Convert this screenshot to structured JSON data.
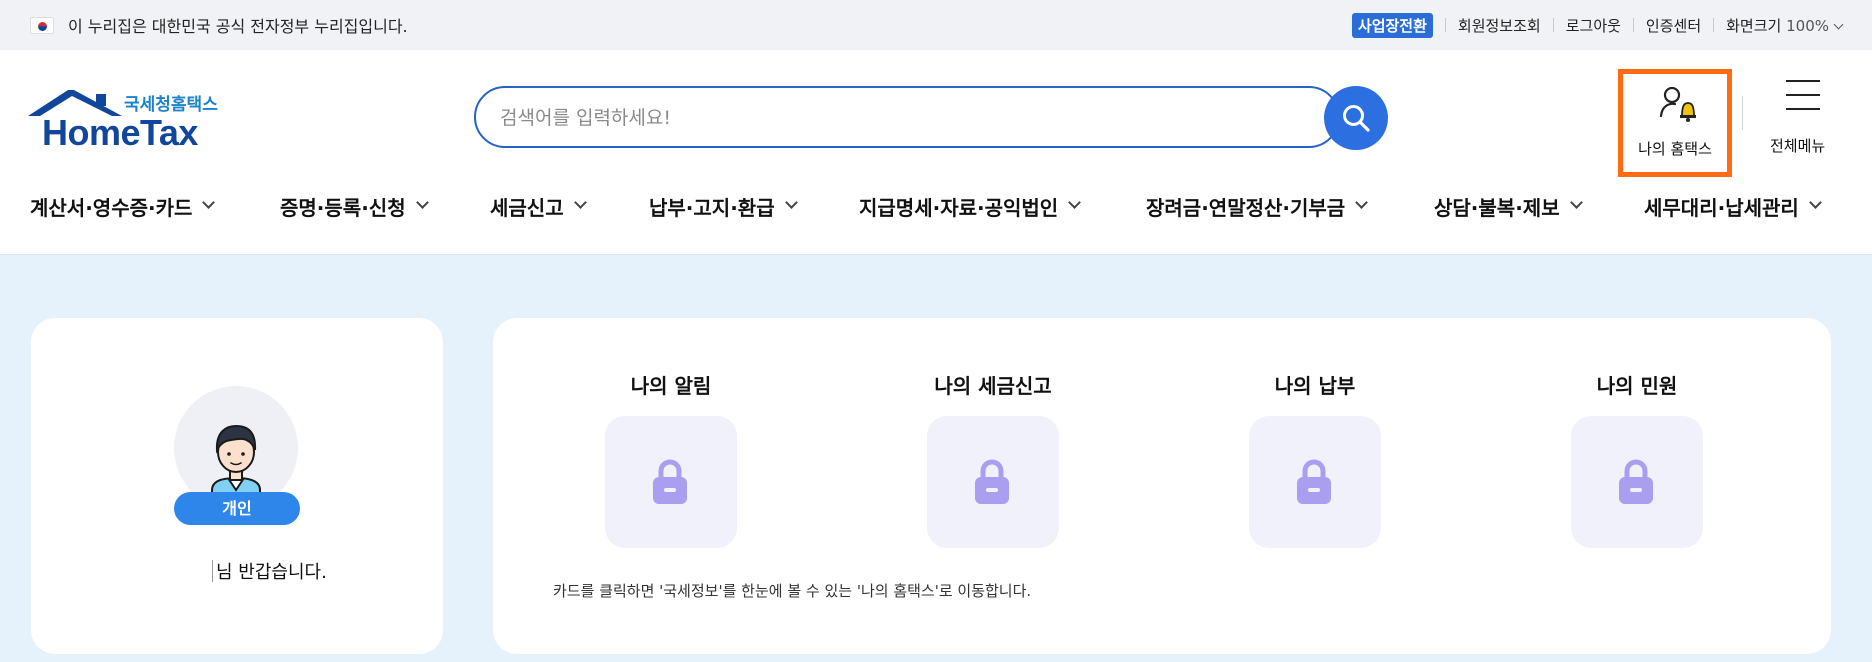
{
  "gov_strip": {
    "text": "이 누리집은 대한민국 공식 전자정부 누리집입니다.",
    "links": [
      "회원정보조회",
      "로그아웃",
      "인증센터"
    ],
    "biz_switch": "사업장전환",
    "zoom_label": "화면크기",
    "zoom_value": "100%"
  },
  "header": {
    "logo_sub": "국세청홈택스",
    "logo_main": "HomeTax",
    "search_placeholder": "검색어를 입력하세요!",
    "my_hometax": "나의 홈택스",
    "all_menu": "전체메뉴"
  },
  "gnb": [
    "계산서·영수증·카드",
    "증명·등록·신청",
    "세금신고",
    "납부·고지·환급",
    "지급명세·자료·공익법인",
    "장려금·연말정산·기부금",
    "상담·불복·제보",
    "세무대리·납세관리"
  ],
  "profile": {
    "badge": "개인",
    "greeting": "님 반갑습니다."
  },
  "my_cards": {
    "items": [
      "나의 알림",
      "나의 세금신고",
      "나의 납부",
      "나의 민원"
    ],
    "hint": "카드를 클릭하면 '국세정보'를 한눈에 볼 수 있는 '나의 홈택스'로 이동합니다."
  },
  "colors": {
    "accent": "#2c6fe0",
    "highlight": "#ff6a13",
    "lock": "#a99ef0"
  }
}
